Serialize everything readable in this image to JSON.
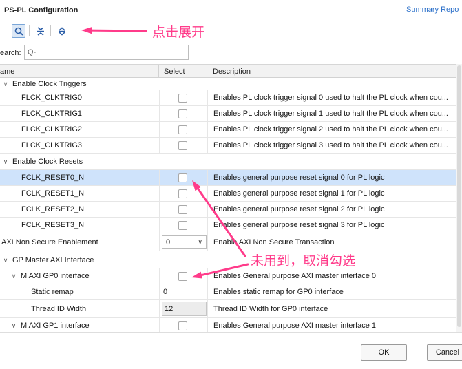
{
  "window": {
    "title": "PS-PL Configuration",
    "summary_link": "Summary Repo"
  },
  "toolbar": {
    "items": [
      "search-icon",
      "collapse-all-icon",
      "expand-all-icon"
    ]
  },
  "search": {
    "label": "earch:",
    "placeholder": "Q-"
  },
  "table": {
    "columns": [
      "ame",
      "Select",
      "Description"
    ],
    "rows": [
      {
        "name": "Enable Clock Triggers",
        "kind": "group",
        "expanded": true
      },
      {
        "name": "FLCK_CLKTRIG0",
        "kind": "checkbox",
        "checked": false,
        "description": "Enables PL clock trigger signal 0 used to halt the PL clock when cou..."
      },
      {
        "name": "FLCK_CLKTRIG1",
        "kind": "checkbox",
        "checked": false,
        "description": "Enables PL clock trigger signal 1 used to halt the PL clock when cou..."
      },
      {
        "name": "FLCK_CLKTRIG2",
        "kind": "checkbox",
        "checked": false,
        "description": "Enables PL clock trigger signal 2 used to halt the PL clock when cou..."
      },
      {
        "name": "FLCK_CLKTRIG3",
        "kind": "checkbox",
        "checked": false,
        "description": "Enables PL clock trigger signal 3 used to halt the PL clock when cou..."
      },
      {
        "name": "Enable Clock Resets",
        "kind": "group",
        "expanded": true
      },
      {
        "name": "FCLK_RESET0_N",
        "kind": "checkbox",
        "checked": false,
        "selected": true,
        "description": "Enables general purpose reset signal 0 for PL logic"
      },
      {
        "name": "FCLK_RESET1_N",
        "kind": "checkbox",
        "checked": false,
        "description": "Enables general purpose reset signal 1 for PL logic"
      },
      {
        "name": "FCLK_RESET2_N",
        "kind": "checkbox",
        "checked": false,
        "description": "Enables general purpose reset signal 2 for PL logic"
      },
      {
        "name": "FCLK_RESET3_N",
        "kind": "checkbox",
        "checked": false,
        "description": "Enables general purpose reset signal 3 for PL logic"
      },
      {
        "name": "AXI Non Secure Enablement",
        "kind": "combo",
        "value": "0",
        "description": "Enable AXI Non Secure Transaction"
      },
      {
        "name": "GP Master AXI Interface",
        "kind": "group",
        "expanded": true
      },
      {
        "name": "M AXI GP0 interface",
        "kind": "checkbox",
        "checked": false,
        "expandable": true,
        "description": "Enables General purpose AXI master interface 0"
      },
      {
        "name": "Static remap",
        "kind": "value",
        "value": "0",
        "description": "Enables static remap for GP0 interface"
      },
      {
        "name": "Thread ID Width",
        "kind": "valuebox",
        "value": "12",
        "description": "Thread ID Width for GP0 interface"
      },
      {
        "name": "M AXI GP1 interface",
        "kind": "checkbox",
        "checked": false,
        "expandable": true,
        "description": "Enables General purpose AXI master interface 1"
      }
    ]
  },
  "footer": {
    "ok_label": "OK",
    "cancel_label": "Cancel"
  },
  "annotations": {
    "expand_note": "点击展开",
    "uncheck_note": "未用到，取消勾选",
    "color": "#ff3b8a"
  }
}
